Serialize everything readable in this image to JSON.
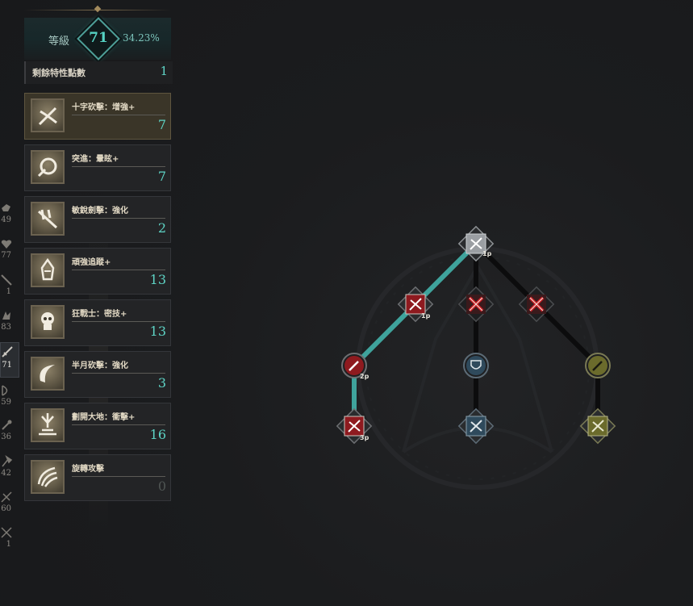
{
  "header": {
    "level_label": "等級",
    "level_value": "71",
    "level_percent": "34.23%"
  },
  "points": {
    "label": "剩餘特性點數",
    "value": "1"
  },
  "categories": [
    {
      "icon": "fist-icon",
      "value": "49"
    },
    {
      "icon": "heart-icon",
      "value": "77"
    },
    {
      "icon": "needle-icon",
      "value": "1"
    },
    {
      "icon": "claw-icon",
      "value": "83"
    },
    {
      "icon": "sword-icon",
      "value": "71",
      "active": true
    },
    {
      "icon": "bow-icon",
      "value": "59"
    },
    {
      "icon": "wand-icon",
      "value": "36"
    },
    {
      "icon": "axe-icon",
      "value": "42"
    },
    {
      "icon": "crossbow-icon",
      "value": "60"
    },
    {
      "icon": "crossed-blades-icon",
      "value": "1"
    }
  ],
  "skills": [
    {
      "name": "十字砍擊：增強+",
      "level": "7",
      "selected": true
    },
    {
      "name": "突進：暈眩+",
      "level": "7"
    },
    {
      "name": "敏銳劍擊：強化",
      "level": "2"
    },
    {
      "name": "頑強追蹤+",
      "level": "13"
    },
    {
      "name": "狂戰士：密技+",
      "level": "13"
    },
    {
      "name": "半月砍擊：強化",
      "level": "3"
    },
    {
      "name": "劃開大地：衝擊+",
      "level": "16"
    },
    {
      "name": "旋轉攻擊",
      "level": "0"
    }
  ],
  "tree": {
    "nodes": [
      {
        "id": "root",
        "label": "1p",
        "style": "silver"
      },
      {
        "id": "left-1",
        "label": "1p",
        "style": "red"
      },
      {
        "id": "mid-1",
        "label": "",
        "style": "blocked"
      },
      {
        "id": "right-1",
        "label": "",
        "style": "blocked"
      },
      {
        "id": "left-2",
        "label": "2p",
        "style": "red-round"
      },
      {
        "id": "mid-2",
        "label": "",
        "style": "blue-round"
      },
      {
        "id": "right-2",
        "label": "",
        "style": "olive-round"
      },
      {
        "id": "left-3",
        "label": "3p",
        "style": "red"
      },
      {
        "id": "mid-3",
        "label": "",
        "style": "blue"
      },
      {
        "id": "right-3",
        "label": "",
        "style": "olive"
      }
    ],
    "colors": {
      "active_path": "#3fa39c",
      "inactive_path": "#0c0c0d",
      "red": "#8e1a1f",
      "blue": "#2f4a5c",
      "olive": "#6b6b2c",
      "silver": "#9a9ea2"
    }
  }
}
